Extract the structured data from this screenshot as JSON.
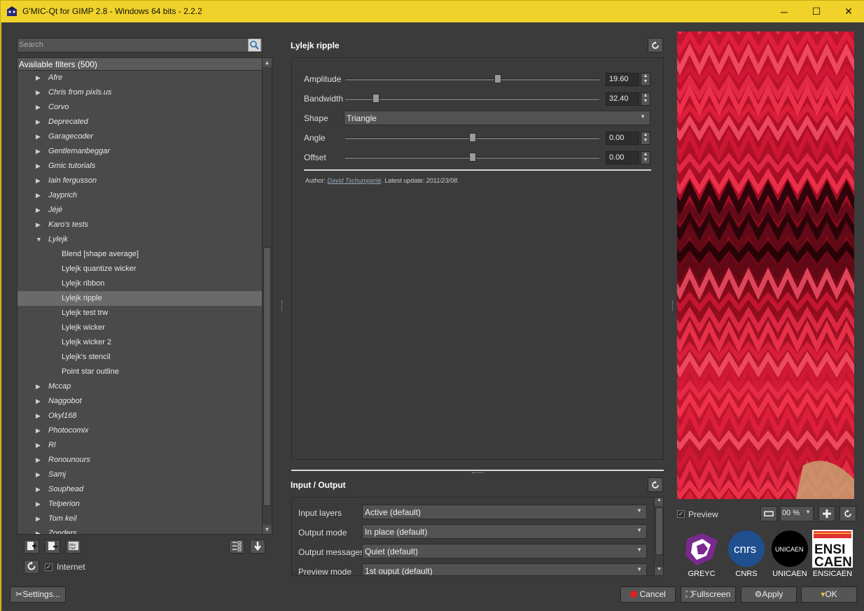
{
  "window": {
    "title": "G'MIC-Qt for GIMP 2.8 - Windows 64 bits - 2.2.2",
    "minimize": "─",
    "maximize": "☐",
    "close": "✕"
  },
  "filters_panel": {
    "search_placeholder": "Search",
    "header": "Available filters (500)",
    "items": [
      {
        "label": "Afre",
        "type": "category"
      },
      {
        "label": "Chris from pixls.us",
        "type": "category"
      },
      {
        "label": "Corvo",
        "type": "category"
      },
      {
        "label": "Deprecated",
        "type": "category"
      },
      {
        "label": "Garagecoder",
        "type": "category"
      },
      {
        "label": "Gentlemanbeggar",
        "type": "category"
      },
      {
        "label": "Gmic tutorials",
        "type": "category"
      },
      {
        "label": "Iain fergusson",
        "type": "category"
      },
      {
        "label": "Jayprich",
        "type": "category"
      },
      {
        "label": "Jéjé",
        "type": "category"
      },
      {
        "label": "Karo's tests",
        "type": "category"
      },
      {
        "label": "Lylejk",
        "type": "category-open"
      },
      {
        "label": "Blend [shape average]",
        "type": "filter"
      },
      {
        "label": "Lylejk quantize wicker",
        "type": "filter"
      },
      {
        "label": "Lylejk ribbon",
        "type": "filter"
      },
      {
        "label": "Lylejk ripple",
        "type": "filter-selected"
      },
      {
        "label": "Lylejk test trw",
        "type": "filter"
      },
      {
        "label": "Lylejk wicker",
        "type": "filter"
      },
      {
        "label": "Lylejk wicker 2",
        "type": "filter"
      },
      {
        "label": "Lylejk's stencil",
        "type": "filter"
      },
      {
        "label": "Point star outline",
        "type": "filter"
      },
      {
        "label": "Mccap",
        "type": "category"
      },
      {
        "label": "Naggobot",
        "type": "category"
      },
      {
        "label": "Okyl168",
        "type": "category"
      },
      {
        "label": "Photocomix",
        "type": "category"
      },
      {
        "label": "Rl",
        "type": "category"
      },
      {
        "label": "Ronounours",
        "type": "category"
      },
      {
        "label": "Samj",
        "type": "category"
      },
      {
        "label": "Souphead",
        "type": "category"
      },
      {
        "label": "Telperion",
        "type": "category"
      },
      {
        "label": "Tom keil",
        "type": "category"
      },
      {
        "label": "Zonders",
        "type": "category"
      }
    ],
    "internet_label": "Internet",
    "internet_checked": true
  },
  "filter": {
    "title": "Lylejk ripple",
    "params": {
      "amplitude": {
        "label": "Amplitude",
        "value": "19.60",
        "fraction": 0.6
      },
      "bandwidth": {
        "label": "Bandwidth",
        "value": "32.40",
        "fraction": 0.12
      },
      "shape": {
        "label": "Shape",
        "value": "Triangle"
      },
      "angle": {
        "label": "Angle",
        "value": "0.00",
        "fraction": 0.5
      },
      "offset": {
        "label": "Offset",
        "value": "0.00",
        "fraction": 0.5
      }
    },
    "author_prefix": "Author: ",
    "author_name": "David Tschumperlé",
    "update_prefix": ". Latest update: ",
    "update_date": "2011/23/08."
  },
  "io": {
    "title": "Input / Output",
    "input_layers": {
      "label": "Input layers",
      "value": "Active (default)"
    },
    "output_mode": {
      "label": "Output mode",
      "value": "In place (default)"
    },
    "output_messages": {
      "label": "Output messages",
      "value": "Quiet (default)"
    },
    "preview_mode": {
      "label": "Preview mode",
      "value": "1st ouput (default)"
    }
  },
  "preview": {
    "label": "Preview",
    "checked": true,
    "zoom": "00 %"
  },
  "logos": [
    "GREYC",
    "CNRS",
    "UNICAEN",
    "ENSICAEN"
  ],
  "logo_marks": {
    "cnrs": "cnrs",
    "unicaen": "UNICAEN",
    "ensi": "ENSI",
    "caen": "CAEN"
  },
  "buttons": {
    "settings": "Settings...",
    "cancel": "Cancel",
    "fullscreen": "Fullscreen",
    "apply": "Apply",
    "ok": "OK"
  }
}
